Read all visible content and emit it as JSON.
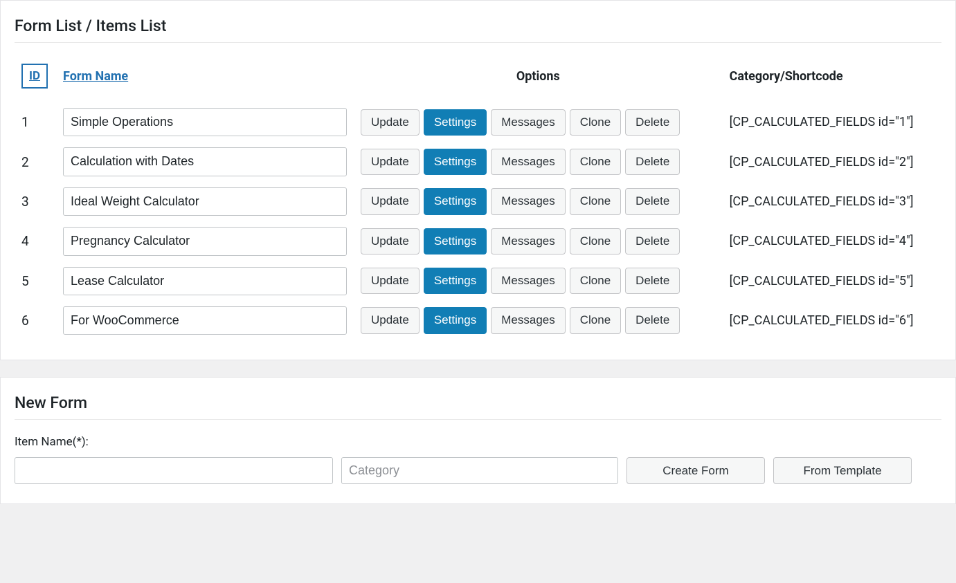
{
  "list": {
    "title": "Form List / Items List",
    "headers": {
      "id": "ID",
      "name": "Form Name",
      "options": "Options",
      "category": "Category/Shortcode"
    },
    "buttons": {
      "update": "Update",
      "settings": "Settings",
      "messages": "Messages",
      "clone": "Clone",
      "delete": "Delete"
    },
    "rows": [
      {
        "id": "1",
        "name": "Simple Operations",
        "shortcode": "[CP_CALCULATED_FIELDS id=\"1\"]"
      },
      {
        "id": "2",
        "name": "Calculation with Dates",
        "shortcode": "[CP_CALCULATED_FIELDS id=\"2\"]"
      },
      {
        "id": "3",
        "name": "Ideal Weight Calculator",
        "shortcode": "[CP_CALCULATED_FIELDS id=\"3\"]"
      },
      {
        "id": "4",
        "name": "Pregnancy Calculator",
        "shortcode": "[CP_CALCULATED_FIELDS id=\"4\"]"
      },
      {
        "id": "5",
        "name": "Lease Calculator",
        "shortcode": "[CP_CALCULATED_FIELDS id=\"5\"]"
      },
      {
        "id": "6",
        "name": "For WooCommerce",
        "shortcode": "[CP_CALCULATED_FIELDS id=\"6\"]"
      }
    ]
  },
  "newform": {
    "title": "New Form",
    "item_name_label": "Item Name(*):",
    "name_value": "",
    "category_placeholder": "Category",
    "create_label": "Create Form",
    "template_label": "From Template"
  }
}
